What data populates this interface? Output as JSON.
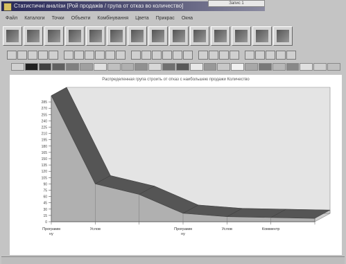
{
  "window": {
    "title": "Статистичні аналізи [Рой продажів / група от отказ во количество]",
    "popup": "Запис 1"
  },
  "menu": [
    "Файл",
    "Каталоги",
    "Точки",
    "Объекти",
    "Комбінування",
    "Цвета",
    "Прикрас",
    "Окна"
  ],
  "toolbar_icons": [
    "select-icon",
    "chart-wizard-icon",
    "grid-icon",
    "data-icon",
    "brush-icon",
    "bar-chart-icon",
    "bar3d-chart-icon",
    "histogram-icon",
    "line-chart-icon",
    "monitor-icon",
    "column-chart-icon",
    "pie-chart-icon",
    "area-chart-icon",
    "print-icon"
  ],
  "palette": [
    "#d0d0d0",
    "#202020",
    "#404040",
    "#606060",
    "#808080",
    "#a0a0a0",
    "#e0e0e0",
    "#c0c0c0",
    "#b0b0b0",
    "#909090",
    "#d8d8d8",
    "#707070",
    "#585858",
    "#e8e8e8",
    "#989898",
    "#c8c8c8",
    "#f0f0f0",
    "#a8a8a8",
    "#787878",
    "#b8b8b8",
    "#888888",
    "#e0e0e0",
    "#d0d0d0",
    "#c0c0c0"
  ],
  "chart_title": "Распределенная група строить от отказ с наибольшею продажи Количество",
  "chart_data": {
    "type": "area",
    "title": "Распределенная група строить от отказ с наибольшею продажи Количество",
    "categories": [
      "Программ ну",
      "Услов",
      "",
      "Программ ну",
      "Услов",
      "Комментр",
      ""
    ],
    "values": [
      300,
      90,
      65,
      20,
      12,
      10,
      8
    ],
    "ylim": [
      0,
      300
    ],
    "yticks": [
      0,
      15,
      30,
      45,
      60,
      75,
      90,
      105,
      120,
      135,
      150,
      165,
      180,
      195,
      210,
      225,
      240,
      255,
      270,
      285
    ],
    "grid": false,
    "colors": {
      "front": "#555555",
      "fill": "#b0b0b0",
      "floor": "#cfcfcf",
      "wall": "#e4e4e4"
    }
  }
}
